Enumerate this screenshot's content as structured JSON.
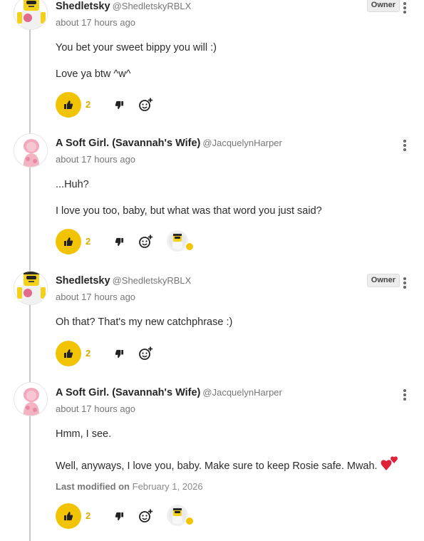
{
  "comments": [
    {
      "author": "Shedletsky",
      "handle": "@ShedletskyRBLX",
      "time": "about 17 hours ago",
      "badge": "Owner",
      "avatar": "shedletsky-avatar",
      "lines": [
        "You bet your sweet bippy you will :)",
        "Love ya btw ^w^"
      ],
      "likes": "2",
      "reaction": null
    },
    {
      "author": "A Soft Girl. (Savannah's Wife)",
      "handle": "@JacquelynHarper",
      "time": "about 17 hours ago",
      "avatar": "soft-girl-avatar",
      "lines": [
        "...Huh?",
        "I love you too, baby, but what was that word you just said?"
      ],
      "likes": "2",
      "reaction": "avatar-with-heart"
    },
    {
      "author": "Shedletsky",
      "handle": "@ShedletskyRBLX",
      "time": "about 17 hours ago",
      "badge": "Owner",
      "avatar": "shedletsky-avatar",
      "lines": [
        "Oh that? That's my new catchphrase :)"
      ],
      "likes": "2",
      "reaction": null
    },
    {
      "author": "A Soft Girl. (Savannah's Wife)",
      "handle": "@JacquelynHarper",
      "time": "about 17 hours ago",
      "avatar": "soft-girl-avatar",
      "lines": [
        "Hmm, I see.",
        "Well, anyways, I love you, baby. Make sure to keep Rosie safe. Mwah."
      ],
      "modified_label": "Last modified on",
      "modified_date": "February 1, 2026",
      "likes": "2",
      "reaction": "avatar-with-heart"
    }
  ],
  "colors": {
    "like_button": "#f2c300",
    "like_count": "#d6ab00",
    "thread_line": "#c8c8c8",
    "heart": "#e0213a"
  }
}
